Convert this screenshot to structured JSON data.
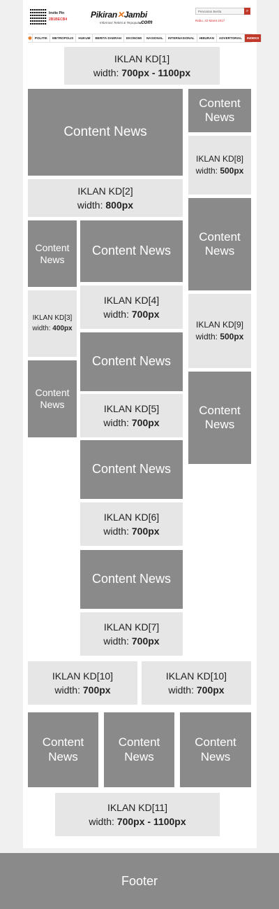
{
  "header": {
    "invite_label": "Invite Pin",
    "invite_pin": "2B1BECB4",
    "logo_part1": "Pikiran",
    "logo_part2": "Jambi",
    "logo_suffix": ".com",
    "tagline": "Informasi Terkini & Terpopuler",
    "search_placeholder": "Pencarian Berita",
    "date": "Rabu, 22 Maret 2017"
  },
  "nav": {
    "items": [
      "POLITIK",
      "METROPOLIS",
      "HUKUM",
      "BERITA DAERAH",
      "EKONOMI",
      "NASIONAL",
      "INTERNASIONAL",
      "HIBURAN",
      "ADVERTORIAL",
      "INDEKS"
    ],
    "active_index": 9
  },
  "content_label": "Content News",
  "ads": {
    "kd1": {
      "title": "IKLAN KD[1]",
      "prefix": "width:",
      "size": "700px - 1100px"
    },
    "kd2": {
      "title": "IKLAN KD[2]",
      "prefix": "width:",
      "size": "800px"
    },
    "kd3": {
      "title": "IKLAN KD[3]",
      "prefix": "width:",
      "size": "400px"
    },
    "kd4": {
      "title": "IKLAN KD[4]",
      "prefix": "width:",
      "size": "700px"
    },
    "kd5": {
      "title": "IKLAN KD[5]",
      "prefix": "width:",
      "size": "700px"
    },
    "kd6": {
      "title": "IKLAN KD[6]",
      "prefix": "width:",
      "size": "700px"
    },
    "kd7": {
      "title": "IKLAN KD[7]",
      "prefix": "width:",
      "size": "700px"
    },
    "kd8": {
      "title": "IKLAN KD[8]",
      "prefix": "width:",
      "size": "500px"
    },
    "kd9": {
      "title": "IKLAN KD[9]",
      "prefix": "width:",
      "size": "500px"
    },
    "kd10a": {
      "title": "IKLAN KD[10]",
      "prefix": "width:",
      "size": "700px"
    },
    "kd10b": {
      "title": "IKLAN KD[10]",
      "prefix": "width:",
      "size": "700px"
    },
    "kd11": {
      "title": "IKLAN KD[11]",
      "prefix": "width:",
      "size": "700px - 1100px"
    }
  },
  "footer": {
    "label": "Footer"
  },
  "colors": {
    "news": "#8a8a8a",
    "ad": "#e6e6e6",
    "accent": "#c0392b",
    "logo_star": "#e8751a"
  }
}
